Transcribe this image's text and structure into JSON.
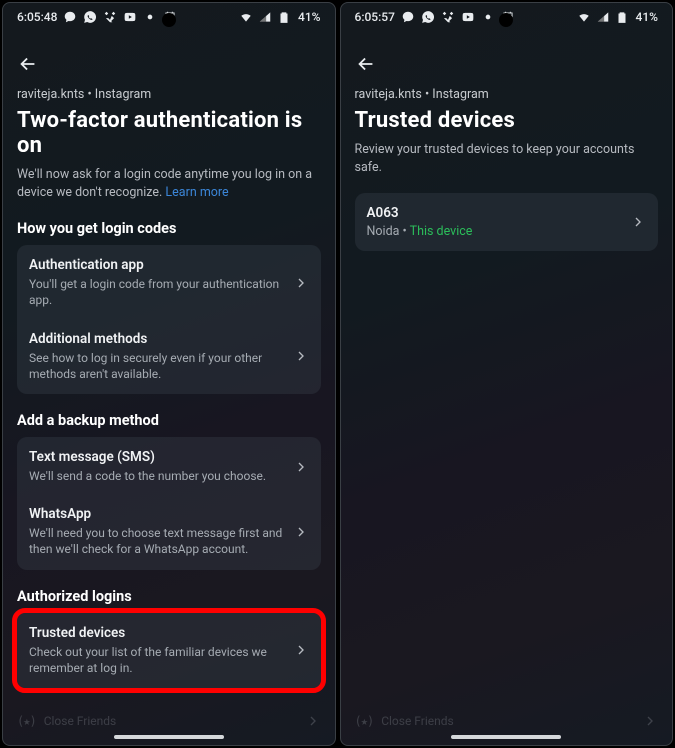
{
  "statusbar": {
    "time_left": "6:05:48",
    "time_right": "6:05:57",
    "battery": "41%"
  },
  "screen1": {
    "breadcrumb": "raviteja.knts • Instagram",
    "title": "Two-factor authentication is on",
    "desc_a": "We'll now ask for a login code anytime you log in on a device we don't recognize. ",
    "desc_link": "Learn more",
    "section_codes": "How you get login codes",
    "auth_app_title": "Authentication app",
    "auth_app_sub": "You'll get a login code from your authentication app.",
    "addl_title": "Additional methods",
    "addl_sub": "See how to log in securely even if your other methods aren't available.",
    "section_backup": "Add a backup method",
    "sms_title": "Text message (SMS)",
    "sms_sub": "We'll send a code to the number you choose.",
    "wa_title": "WhatsApp",
    "wa_sub": "We'll need you to choose text message first and then we'll check for a WhatsApp account.",
    "section_auth": "Authorized logins",
    "trusted_title": "Trusted devices",
    "trusted_sub": "Check out your list of the familiar devices we remember at log in.",
    "faint_close": "Close Friends"
  },
  "screen2": {
    "breadcrumb": "raviteja.knts • Instagram",
    "title": "Trusted devices",
    "desc": "Review your trusted devices to keep your accounts safe.",
    "device_name": "A063",
    "device_loc": "Noida",
    "device_dot": " • ",
    "device_this": "This device",
    "faint_close": "Close Friends"
  }
}
